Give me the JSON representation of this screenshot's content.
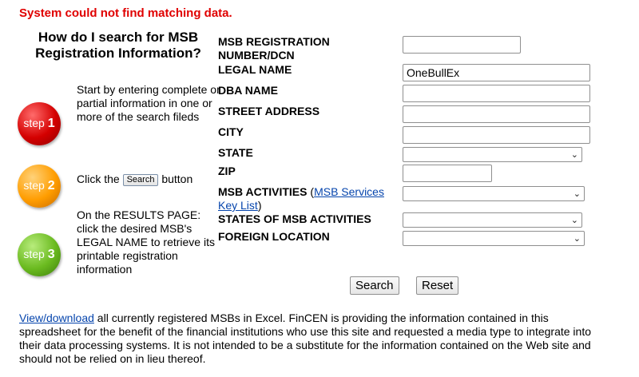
{
  "error_message": "System could not find matching data.",
  "help": {
    "title": "How do I search for MSB Registration Information?",
    "step1": {
      "badge_word": "step",
      "badge_num": "1",
      "text": "Start by entering complete or partial information in one or more of the search fileds"
    },
    "step2": {
      "badge_word": "step",
      "badge_num": "2",
      "text_before": "Click the",
      "button_label": "Search",
      "text_after": "button"
    },
    "step3": {
      "badge_word": "step",
      "badge_num": "3",
      "text": "On the RESULTS PAGE: click the desired MSB's LEGAL NAME to retrieve its printable registration information"
    }
  },
  "form": {
    "msb_reg_label": "MSB REGISTRATION NUMBER/DCN",
    "msb_reg_value": "",
    "legal_name_label": "LEGAL NAME",
    "legal_name_value": "OneBullEx",
    "dba_label": "DBA NAME",
    "dba_value": "",
    "street_label": "STREET ADDRESS",
    "street_value": "",
    "city_label": "CITY",
    "city_value": "",
    "state_label": "STATE",
    "state_value": "",
    "zip_label": "ZIP",
    "zip_value": "",
    "msb_activities_label": "MSB ACTIVITIES",
    "msb_activities_paren_open": "(",
    "msb_activities_link": "MSB Services Key List",
    "msb_activities_paren_close": ")",
    "msb_activities_value": "",
    "states_activities_label": "STATES OF MSB ACTIVITIES",
    "states_activities_value": "",
    "foreign_location_label": "FOREIGN LOCATION",
    "foreign_location_value": "",
    "search_button": "Search",
    "reset_button": "Reset"
  },
  "footer": {
    "link_text": "View/download",
    "text": " all currently registered MSBs in Excel. FinCEN is providing the information contained in this spreadsheet for the benefit of the financial institutions who use this site and requested a media type to integrate into their data processing systems. It is not intended to be a substitute for the information contained on the Web site and should not be relied on in lieu thereof."
  },
  "colors": {
    "error": "#e00000",
    "link": "#0645ad",
    "step1": "#d40000",
    "step2": "#ff9d00",
    "step3": "#6aba1f"
  },
  "icons": {
    "select_chevron": "chevron-down-icon"
  }
}
